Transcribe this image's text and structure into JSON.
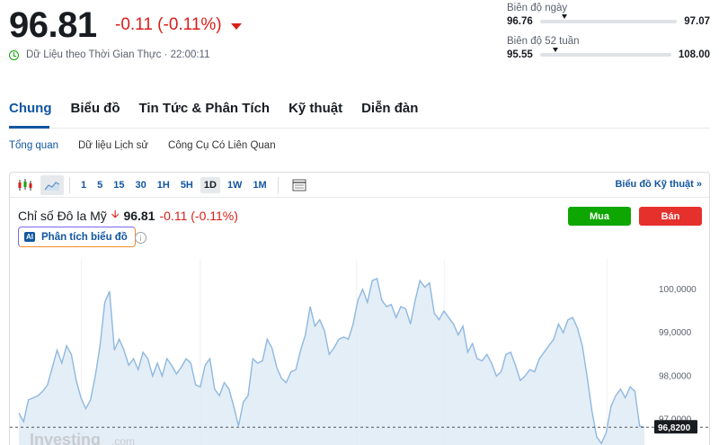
{
  "quote": {
    "price": "96.81",
    "change": "-0.11 (-0.11%)",
    "realtime": "Dữ Liệu theo Thời Gian Thực · 22:00:11"
  },
  "day_range": {
    "label": "Biên độ ngày",
    "low": "96.76",
    "high": "97.07",
    "marker_fraction": 0.16
  },
  "week52_range": {
    "label": "Biên độ 52 tuần",
    "low": "95.55",
    "high": "108.00",
    "marker_fraction": 0.1
  },
  "main_tabs": [
    "Chung",
    "Biểu đồ",
    "Tin Tức & Phân Tích",
    "Kỹ thuật",
    "Diễn đàn"
  ],
  "sub_tabs": [
    "Tổng quan",
    "Dữ liệu Lịch sử",
    "Công Cụ Có Liên Quan"
  ],
  "toolbar": {
    "timeframes": [
      "1",
      "5",
      "15",
      "30",
      "1H",
      "5H",
      "1D",
      "1W",
      "1M"
    ],
    "active_timeframe": "1D",
    "tech_link": "Biểu đồ Kỹ thuật »"
  },
  "instrument": {
    "name": "Chỉ số Đô la Mỹ",
    "price": "96.81",
    "change": "-0.11 (-0.11%)"
  },
  "ai_button": {
    "badge": "AI",
    "label": "Phân tích biểu đồ"
  },
  "buttons": {
    "buy": "Mua",
    "sell": "Bán"
  },
  "watermark": {
    "brand": "Investing",
    "suffix": ".com"
  },
  "colors": {
    "accent": "#1256a0",
    "down": "#d91e18",
    "buy": "#0ea600",
    "sell": "#e5302c",
    "line": "#8fb8e0",
    "fill": "#dbe8f4"
  },
  "chart_data": {
    "type": "area",
    "y_ticks": [
      "100,0000",
      "99,0000",
      "98,0000",
      "97,0000"
    ],
    "y_tick_values": [
      100,
      99,
      98,
      97
    ],
    "current_label": "96,8200",
    "current_value": 96.82,
    "ylim": [
      96.35,
      100.7
    ],
    "values": [
      97.15,
      96.95,
      97.45,
      97.5,
      97.55,
      97.65,
      97.8,
      98.2,
      98.6,
      98.3,
      98.7,
      98.5,
      97.9,
      97.5,
      97.25,
      97.45,
      98.0,
      98.7,
      99.7,
      99.95,
      98.6,
      98.85,
      98.6,
      98.25,
      98.4,
      98.15,
      98.55,
      98.4,
      98.0,
      98.3,
      98.0,
      98.4,
      98.25,
      98.05,
      98.2,
      98.4,
      98.3,
      97.8,
      97.75,
      98.25,
      98.4,
      97.7,
      97.55,
      97.85,
      97.7,
      97.3,
      96.85,
      97.4,
      97.55,
      98.4,
      98.3,
      98.35,
      98.85,
      98.65,
      98.2,
      97.95,
      97.85,
      98.1,
      98.15,
      98.6,
      98.95,
      99.6,
      99.15,
      99.3,
      99.05,
      98.5,
      98.65,
      98.85,
      98.9,
      98.85,
      99.2,
      99.75,
      100.0,
      99.7,
      100.2,
      100.25,
      99.75,
      99.6,
      99.65,
      99.35,
      99.6,
      99.55,
      99.2,
      99.75,
      100.2,
      100.05,
      100.15,
      99.45,
      99.3,
      99.5,
      99.35,
      99.2,
      98.95,
      99.15,
      98.55,
      98.75,
      98.4,
      98.35,
      98.5,
      98.3,
      98.0,
      98.1,
      98.5,
      98.55,
      98.25,
      97.9,
      98.0,
      98.15,
      98.1,
      98.4,
      98.55,
      98.7,
      98.85,
      99.2,
      99.0,
      99.3,
      99.35,
      99.1,
      98.7,
      98.0,
      97.2,
      96.6,
      96.45,
      96.7,
      97.3,
      97.55,
      97.7,
      97.5,
      97.75,
      97.65,
      96.85,
      96.82
    ]
  }
}
